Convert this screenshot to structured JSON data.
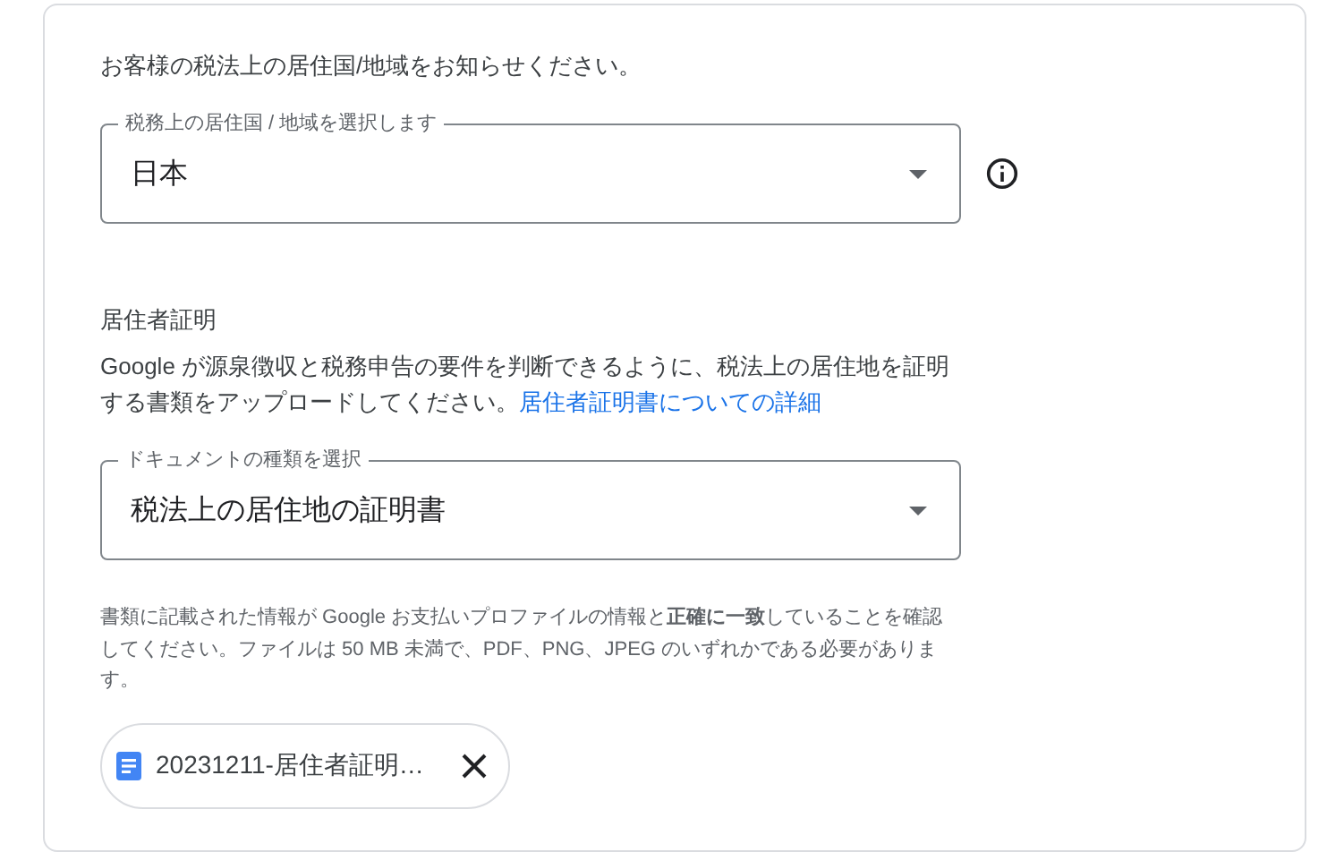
{
  "intro": "お客様の税法上の居住国/地域をお知らせください。",
  "country_select": {
    "label": "税務上の居住国 / 地域を選択します",
    "value": "日本"
  },
  "residency": {
    "heading": "居住者証明",
    "text": "Google が源泉徴収と税務申告の要件を判断できるように、税法上の居住地を証明する書類をアップロードしてください。",
    "link": "居住者証明書についての詳細"
  },
  "document_select": {
    "label": "ドキュメントの種類を選択",
    "value": "税法上の居住地の証明書"
  },
  "note": "書類に記載された情報が Google お支払いプロファイルの情報と**正確に一致**していることを確認してください。ファイルは 50 MB 未満で、PDF、PNG、JPEG のいずれかである必要があります。",
  "file_chip": {
    "name": "20231211-居住者証明…"
  }
}
